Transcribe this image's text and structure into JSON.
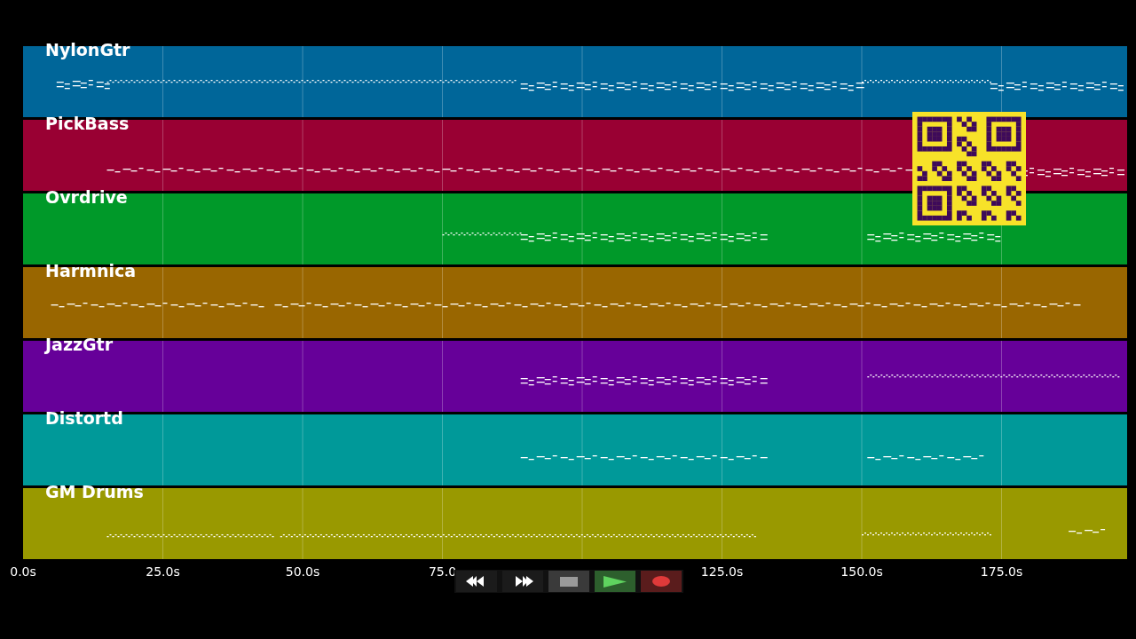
{
  "tracks": [
    {
      "name": "NylonGtr",
      "color": "#006699"
    },
    {
      "name": "PickBass",
      "color": "#990033"
    },
    {
      "name": "Ovrdrive",
      "color": "#009929"
    },
    {
      "name": "Harmnica",
      "color": "#996600"
    },
    {
      "name": "JazzGtr",
      "color": "#660099"
    },
    {
      "name": "Distortd",
      "color": "#009999"
    },
    {
      "name": "GM Drums",
      "color": "#999900"
    }
  ],
  "time_axis": {
    "tick_labels": [
      "0.0s",
      "25.0s",
      "50.0s",
      "75.0",
      "125.0s",
      "150.0s",
      "175.0s"
    ]
  }
}
